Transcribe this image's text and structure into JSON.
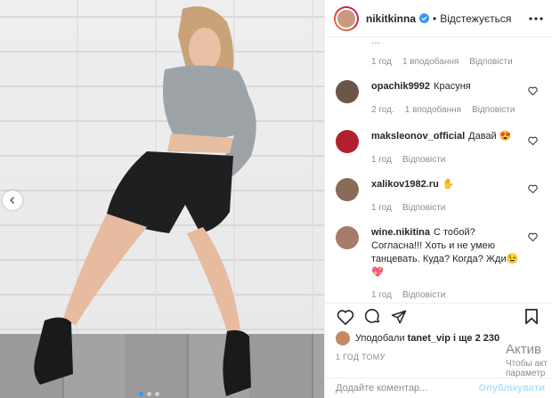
{
  "header": {
    "username": "nikitkinna",
    "separator": "•",
    "follow_status": "Відстежується"
  },
  "comments": {
    "top_snippet_text": "...",
    "top_meta": {
      "time": "1 год",
      "likes": "1 вподобання",
      "reply": "Відповісти"
    },
    "items": [
      {
        "user": "opachik9992",
        "text": "Красуня",
        "time": "2 год.",
        "likes": "1 вподобання",
        "reply": "Відповісти"
      },
      {
        "user": "maksleonov_official",
        "text": "Давай 😍",
        "time": "1 год",
        "reply": "Відповісти"
      },
      {
        "user": "xalikov1982.ru",
        "text": "✋",
        "time": "1 год",
        "reply": "Відповісти"
      },
      {
        "user": "wine.nikitina",
        "text": "С тобой? Согласна!!! Хоть и не умею танцевать. Куда? Когда? Жди😉💖",
        "time": "1 год",
        "reply": "Відповісти"
      }
    ]
  },
  "likes": {
    "prefix": "Уподобали",
    "user": "tanet_vip",
    "suffix": "і ще 2 230"
  },
  "time_ago": "1 ГОД ТОМУ",
  "add_comment": {
    "placeholder": "Додайте коментар...",
    "publish": "Опублікувати"
  },
  "watermark": {
    "line1": "Актив",
    "line2": "Чтобы акт",
    "line3": "параметр"
  },
  "colors": {
    "accent": "#3897f0",
    "publish_disabled": "#b2dffc",
    "muted": "#8e8e8e"
  },
  "icons": {
    "carousel_prev": "chevron-left-icon",
    "verified": "verified-badge-icon",
    "more": "more-horizontal-icon",
    "like": "heart-icon",
    "comment": "comment-icon",
    "share": "paper-plane-icon",
    "save": "bookmark-icon"
  }
}
